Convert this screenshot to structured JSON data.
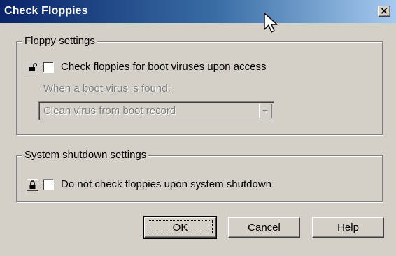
{
  "window": {
    "title": "Check Floppies",
    "close_label": "×"
  },
  "floppy_settings": {
    "legend": "Floppy settings",
    "check_on_access": {
      "label": "Check floppies for boot viruses upon access",
      "checked": false,
      "lock_state": "unlocked"
    },
    "action_label": "When a boot virus is found:",
    "action_select": {
      "value": "Clean virus from boot record",
      "enabled": false
    }
  },
  "shutdown_settings": {
    "legend": "System shutdown settings",
    "no_check_on_shutdown": {
      "label": "Do not check floppies upon system shutdown",
      "checked": false,
      "lock_state": "locked"
    }
  },
  "buttons": {
    "ok": "OK",
    "cancel": "Cancel",
    "help": "Help"
  },
  "colors": {
    "dialog_bg": "#d4d0c8",
    "title_start": "#0a246a",
    "title_end": "#a6caf0",
    "disabled_text": "#808080"
  }
}
